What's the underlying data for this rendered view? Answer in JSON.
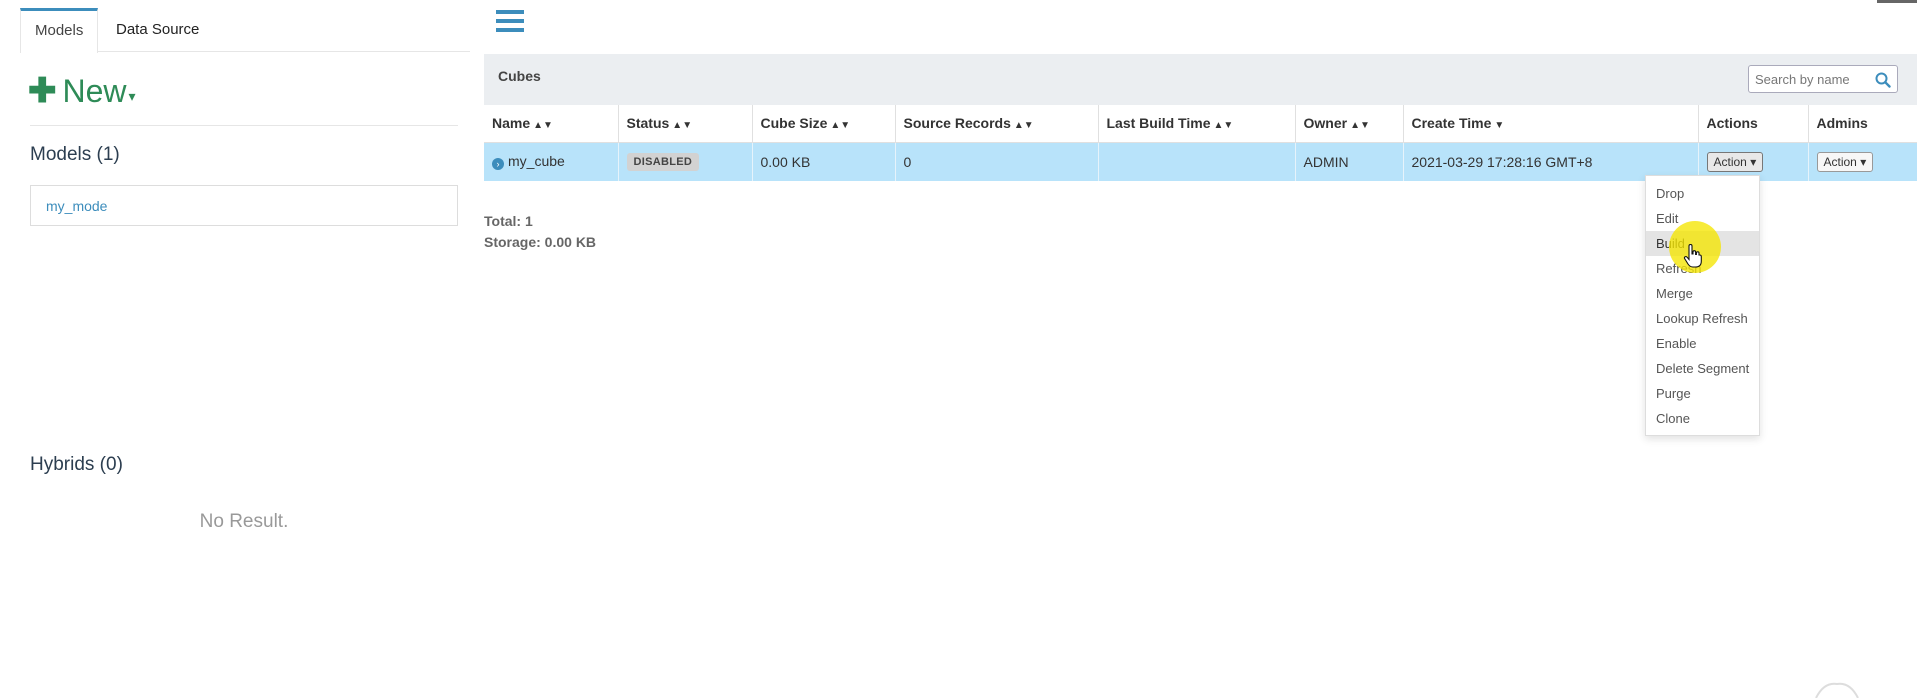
{
  "sidebar": {
    "tabs": [
      {
        "label": "Models",
        "active": true
      },
      {
        "label": "Data Source",
        "active": false
      }
    ],
    "new_label": "New",
    "models_title": "Models (1)",
    "models": [
      "my_mode"
    ],
    "hybrids_title": "Hybrids (0)",
    "hybrids_empty": "No Result."
  },
  "cubes": {
    "title": "Cubes",
    "search_placeholder": "Search by name",
    "columns": [
      "Name",
      "Status",
      "Cube Size",
      "Source Records",
      "Last Build Time",
      "Owner",
      "Create Time",
      "Actions",
      "Admins"
    ],
    "rows": [
      {
        "name": "my_cube",
        "status": "DISABLED",
        "cube_size": "0.00 KB",
        "source_records": "0",
        "last_build_time": "",
        "owner": "ADMIN",
        "create_time": "2021-03-29 17:28:16 GMT+8",
        "action_label": "Action",
        "admin_action_label": "Action"
      }
    ],
    "total": "Total: 1",
    "storage": "Storage: 0.00 KB"
  },
  "action_menu": {
    "items": [
      "Drop",
      "Edit",
      "Build",
      "Refresh",
      "Merge",
      "Lookup Refresh",
      "Enable",
      "Delete Segment",
      "Purge",
      "Clone"
    ],
    "highlighted": "Build"
  },
  "colors": {
    "accent": "#3c8dbc",
    "new_button": "#2e8b57",
    "selected_row": "#b8e3fa",
    "panel_header": "#ebeef1"
  }
}
